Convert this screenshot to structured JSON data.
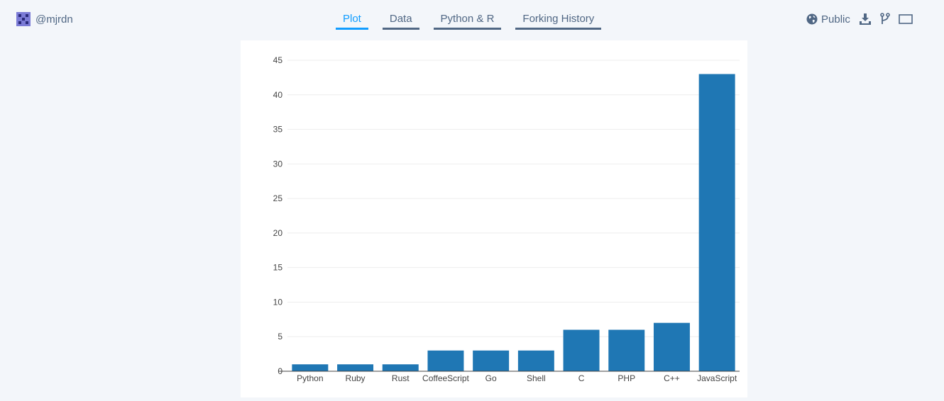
{
  "header": {
    "username": "@mjrdn",
    "tabs": [
      {
        "label": "Plot",
        "active": true
      },
      {
        "label": "Data",
        "active": false
      },
      {
        "label": "Python & R",
        "active": false
      },
      {
        "label": "Forking History",
        "active": false
      }
    ],
    "visibility_label": "Public",
    "icons": [
      "globe-icon",
      "download-icon",
      "fork-icon",
      "fullscreen-icon"
    ]
  },
  "colors": {
    "bar": "#1f77b4",
    "active_tab": "#119dff",
    "text": "#506784",
    "background": "#f3f6fa"
  },
  "chart_data": {
    "type": "bar",
    "categories": [
      "Python",
      "Ruby",
      "Rust",
      "CoffeeScript",
      "Go",
      "Shell",
      "C",
      "PHP",
      "C++",
      "JavaScript"
    ],
    "values": [
      1,
      1,
      1,
      3,
      3,
      3,
      6,
      6,
      7,
      43
    ],
    "title": "",
    "xlabel": "",
    "ylabel": "",
    "ylim": [
      0,
      45
    ],
    "yticks": [
      0,
      5,
      10,
      15,
      20,
      25,
      30,
      35,
      40,
      45
    ],
    "grid": true,
    "legend": "none"
  }
}
